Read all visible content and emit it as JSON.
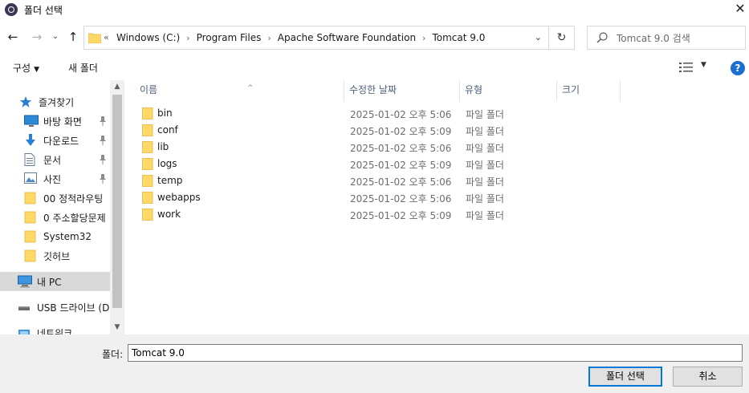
{
  "window": {
    "title": "폴더 선택",
    "close_glyph": "✕"
  },
  "nav_buttons": {
    "back_glyph": "←",
    "forward_glyph": "→",
    "recent_glyph": "⌄",
    "up_glyph": "↑"
  },
  "address": {
    "overflow_glyph": "«",
    "crumbs": [
      "Windows (C:)",
      "Program Files",
      "Apache Software Foundation",
      "Tomcat 9.0"
    ],
    "separator": "›",
    "dropdown_glyph": "⌄",
    "refresh_glyph": "↻"
  },
  "search": {
    "placeholder": "Tomcat 9.0 검색"
  },
  "toolbar": {
    "organize": "구성",
    "organize_caret": "▼",
    "new_folder": "새 폴더",
    "view_caret": "▼",
    "help": "?"
  },
  "nav_pane": {
    "items": [
      {
        "label": "즐겨찾기",
        "icon": "star-icon"
      },
      {
        "label": "바탕 화면",
        "icon": "desktop-icon",
        "pinned": true
      },
      {
        "label": "다운로드",
        "icon": "download-icon",
        "pinned": true
      },
      {
        "label": "문서",
        "icon": "document-icon",
        "pinned": true
      },
      {
        "label": "사진",
        "icon": "picture-icon",
        "pinned": true
      },
      {
        "label": "00 정적라우팅",
        "icon": "folder-icon"
      },
      {
        "label": "0 주소할당문제",
        "icon": "folder-icon"
      },
      {
        "label": "System32",
        "icon": "folder-icon"
      },
      {
        "label": "깃허브",
        "icon": "folder-icon"
      },
      {
        "label": "내 PC",
        "icon": "computer-icon",
        "selected": true
      },
      {
        "label": "USB 드라이브 (D:",
        "icon": "usb-drive-icon"
      },
      {
        "label": "네트워크",
        "icon": "network-icon"
      }
    ],
    "scroll_up_glyph": "▲",
    "scroll_down_glyph": "▼"
  },
  "file_list": {
    "columns": [
      "이름",
      "수정한 날짜",
      "유형",
      "크기"
    ],
    "sort_glyph": "^",
    "rows": [
      {
        "name": "bin",
        "date": "2025-01-02 오후 5:06",
        "type": "파일 폴더"
      },
      {
        "name": "conf",
        "date": "2025-01-02 오후 5:09",
        "type": "파일 폴더"
      },
      {
        "name": "lib",
        "date": "2025-01-02 오후 5:06",
        "type": "파일 폴더"
      },
      {
        "name": "logs",
        "date": "2025-01-02 오후 5:09",
        "type": "파일 폴더"
      },
      {
        "name": "temp",
        "date": "2025-01-02 오후 5:06",
        "type": "파일 폴더"
      },
      {
        "name": "webapps",
        "date": "2025-01-02 오후 5:06",
        "type": "파일 폴더"
      },
      {
        "name": "work",
        "date": "2025-01-02 오후 5:09",
        "type": "파일 폴더"
      }
    ]
  },
  "footer": {
    "folder_label": "폴더:",
    "folder_value": "Tomcat 9.0",
    "select_button": "폴더 선택",
    "cancel_button": "취소"
  },
  "colors": {
    "accent": "#0078d7",
    "folder": "#ffd867",
    "selected_bg": "#d9d9d9",
    "header_text": "#4c607a"
  }
}
